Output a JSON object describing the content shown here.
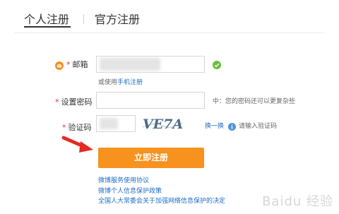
{
  "tabs": {
    "personal": "个人注册",
    "official": "官方注册"
  },
  "email": {
    "label": "邮箱",
    "required_mark": "*",
    "phone_prefix": "或使用",
    "phone_link": "手机注册"
  },
  "password": {
    "label": "设置密码",
    "required_mark": "*",
    "strength": "中",
    "hint": "：您的密码还可以更复杂些"
  },
  "captcha": {
    "label": "验证码",
    "required_mark": "*",
    "image_text": "VE7A",
    "refresh": "换一换",
    "hint": "请输入验证码"
  },
  "submit_label": "立即注册",
  "agreements": [
    "微博服务使用协议",
    "微博个人信息保护政策",
    "全国人大常委会关于加强网络信息保护的决定"
  ],
  "watermark": "Baidu 经验",
  "colors": {
    "accent": "#f7921e",
    "link": "#1d6ec7",
    "required": "#e5332e",
    "ok": "#6bbf3a"
  }
}
